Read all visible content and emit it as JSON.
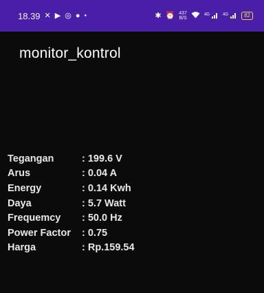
{
  "status_bar": {
    "time": "18.39",
    "left_icons": [
      "close-x",
      "youtube",
      "whatsapp",
      "messenger",
      "dot"
    ],
    "right_icons": [
      "bluetooth",
      "alarm",
      "data-speed",
      "wifi",
      "signal-4g-1",
      "signal-4g-2"
    ],
    "data_speed_value": "437",
    "data_speed_unit": "B/S",
    "signal_1_label": "4G",
    "signal_2_label": "4G",
    "battery": "82",
    "background_color": "#4a1fa8"
  },
  "app": {
    "title": "monitor_kontrol"
  },
  "readings": [
    {
      "label": "Tegangan",
      "value": ": 199.6 V"
    },
    {
      "label": "Arus",
      "value": ": 0.04 A"
    },
    {
      "label": "Energy",
      "value": ": 0.14 Kwh"
    },
    {
      "label": "Daya",
      "value": ": 5.7 Watt"
    },
    {
      "label": "Frequemcy",
      "value": ": 50.0 Hz"
    },
    {
      "label": "Power Factor",
      "value": ": 0.75"
    },
    {
      "label": "Harga",
      "value": ": Rp.159.54"
    }
  ]
}
